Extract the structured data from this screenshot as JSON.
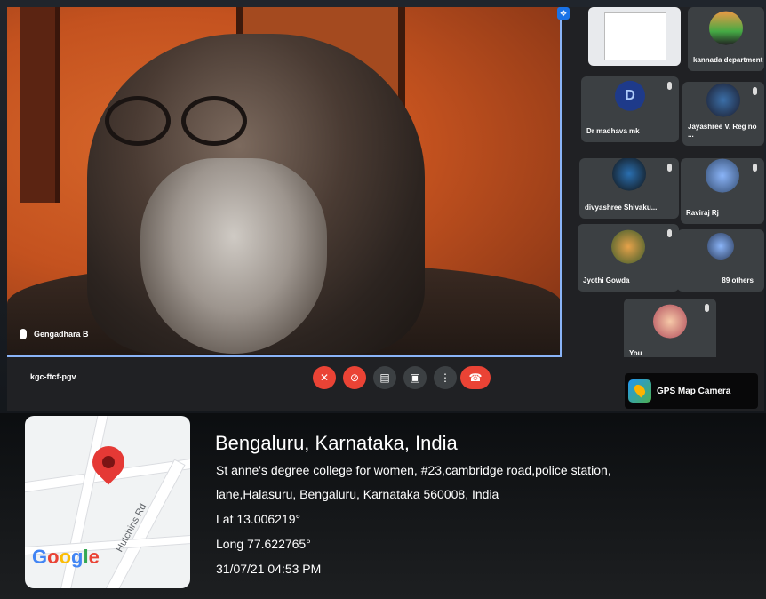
{
  "meeting": {
    "speaker_name": "Gengadhara B",
    "meeting_code": "kgc-ftcf-pgv",
    "participants": [
      {
        "name": "kannada department"
      },
      {
        "name": "Dr madhava mk",
        "initial": "D"
      },
      {
        "name": "Jayashree V. Reg no ..."
      },
      {
        "name": "divyashree Shivaku..."
      },
      {
        "name": "Raviraj Rj"
      },
      {
        "name": "Jyothi Gowda"
      },
      {
        "name": "89 others"
      },
      {
        "name": "You"
      }
    ],
    "accent_color": "#8ab4f8",
    "end_call_color": "#ea4335"
  },
  "gps": {
    "brand": "GPS Map Camera",
    "map_street": "Hutchins Rd",
    "map_logo": "Google",
    "title": "Bengaluru, Karnataka, India",
    "address_line1": "St anne's degree college for women, #23,cambridge road,police station,",
    "address_line2": "lane,Halasuru, Bengaluru, Karnataka 560008, India",
    "lat": "Lat 13.006219°",
    "long": "Long 77.622765°",
    "datetime": "31/07/21 04:53 PM"
  }
}
